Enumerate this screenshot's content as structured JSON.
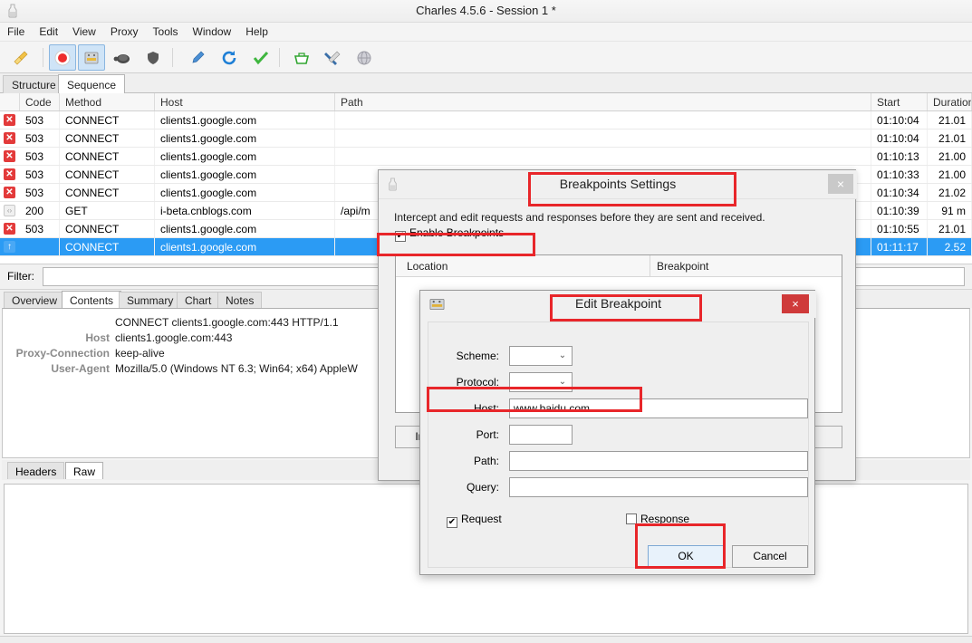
{
  "window": {
    "title": "Charles 4.5.6 - Session 1 *",
    "app_icon": "charles-bottle-icon"
  },
  "menubar": {
    "items": [
      "File",
      "Edit",
      "View",
      "Proxy",
      "Tools",
      "Window",
      "Help"
    ]
  },
  "toolbar": {
    "buttons": [
      {
        "name": "clear-session-icon",
        "glyph": "broom",
        "selected": false
      },
      {
        "name": "record-icon",
        "glyph": "record",
        "selected": true
      },
      {
        "name": "breakpoints-icon",
        "glyph": "breakpoints",
        "selected": true
      },
      {
        "name": "throttling-icon",
        "glyph": "turtle",
        "selected": false
      },
      {
        "name": "ssl-proxying-icon",
        "glyph": "shield",
        "selected": false
      },
      {
        "name": "compose-icon",
        "glyph": "pen",
        "selected": false
      },
      {
        "name": "repeat-icon",
        "glyph": "refresh",
        "selected": false
      },
      {
        "name": "validate-icon",
        "glyph": "check",
        "selected": false
      },
      {
        "name": "dns-spoofing-icon",
        "glyph": "basket",
        "selected": false
      },
      {
        "name": "tools-icon",
        "glyph": "wrench",
        "selected": false
      },
      {
        "name": "map-remote-icon",
        "glyph": "globe",
        "selected": false
      }
    ]
  },
  "session_tabs": {
    "items": [
      "Structure",
      "Sequence"
    ],
    "active": "Sequence"
  },
  "request_table": {
    "columns": [
      "",
      "Code",
      "Method",
      "Host",
      "Path",
      "Start",
      "Duration"
    ],
    "rows": [
      {
        "status": "error",
        "code": "503",
        "method": "CONNECT",
        "host": "clients1.google.com",
        "path": "",
        "start": "01:10:04",
        "duration": "21.01"
      },
      {
        "status": "error",
        "code": "503",
        "method": "CONNECT",
        "host": "clients1.google.com",
        "path": "",
        "start": "01:10:04",
        "duration": "21.01"
      },
      {
        "status": "error",
        "code": "503",
        "method": "CONNECT",
        "host": "clients1.google.com",
        "path": "",
        "start": "01:10:13",
        "duration": "21.00"
      },
      {
        "status": "error",
        "code": "503",
        "method": "CONNECT",
        "host": "clients1.google.com",
        "path": "",
        "start": "01:10:33",
        "duration": "21.00"
      },
      {
        "status": "error",
        "code": "503",
        "method": "CONNECT",
        "host": "clients1.google.com",
        "path": "",
        "start": "01:10:34",
        "duration": "21.02"
      },
      {
        "status": "ok",
        "code": "200",
        "method": "GET",
        "host": "i-beta.cnblogs.com",
        "path": "/api/m",
        "start": "01:10:39",
        "duration": "91 m"
      },
      {
        "status": "error",
        "code": "503",
        "method": "CONNECT",
        "host": "clients1.google.com",
        "path": "",
        "start": "01:10:55",
        "duration": "21.01"
      },
      {
        "status": "pending",
        "code": "",
        "method": "CONNECT",
        "host": "clients1.google.com",
        "path": "",
        "start": "01:11:17",
        "duration": "2.52",
        "selected": true
      }
    ]
  },
  "filter": {
    "label": "Filter:",
    "value": "",
    "placeholder": ""
  },
  "detail_tabs": {
    "items": [
      "Overview",
      "Contents",
      "Summary",
      "Chart",
      "Notes"
    ],
    "active": "Contents"
  },
  "detail_body": {
    "request_line": "CONNECT clients1.google.com:443 HTTP/1.1",
    "headers": [
      {
        "key": "Host",
        "value": "clients1.google.com:443"
      },
      {
        "key": "Proxy-Connection",
        "value": "keep-alive"
      },
      {
        "key": "User-Agent",
        "value": "Mozilla/5.0 (Windows NT 6.3; Win64; x64) AppleW"
      }
    ]
  },
  "view_tabs": {
    "items": [
      "Headers",
      "Raw"
    ],
    "active": "Raw"
  },
  "breakpoints_dialog": {
    "title": "Breakpoints Settings",
    "icon": "charles-bottle-icon",
    "close_label": "×",
    "description": "Intercept and edit requests and responses before they are sent and received.",
    "enable_checkbox": {
      "label": "Enable Breakpoints",
      "checked": true,
      "check_glyph": "✔"
    },
    "table_columns": [
      "Location",
      "Breakpoint"
    ],
    "buttons": [
      {
        "name": "import-button",
        "label": "Im"
      }
    ]
  },
  "edit_breakpoint_dialog": {
    "title": "Edit Breakpoint",
    "icon": "breakpoint-icon",
    "close_label": "×",
    "fields": [
      {
        "name": "scheme",
        "label": "Scheme:",
        "type": "combo",
        "value": ""
      },
      {
        "name": "protocol",
        "label": "Protocol:",
        "type": "combo",
        "value": ""
      },
      {
        "name": "host",
        "label": "Host:",
        "type": "text",
        "value": "www.baidu.com"
      },
      {
        "name": "port",
        "label": "Port:",
        "type": "text-small",
        "value": ""
      },
      {
        "name": "path",
        "label": "Path:",
        "type": "text",
        "value": ""
      },
      {
        "name": "query",
        "label": "Query:",
        "type": "text",
        "value": ""
      }
    ],
    "request_checkbox": {
      "label": "Request",
      "checked": true,
      "check_glyph": "✔"
    },
    "response_checkbox": {
      "label": "Response",
      "checked": false,
      "check_glyph": ""
    },
    "ok_label": "OK",
    "cancel_label": "Cancel",
    "combo_arrow": "⌄"
  },
  "annotations": {
    "color": "#e8262a",
    "boxes": [
      "breakpoints-settings-title",
      "enable-breakpoints-checkbox",
      "edit-breakpoint-title",
      "host-field",
      "ok-button"
    ]
  }
}
